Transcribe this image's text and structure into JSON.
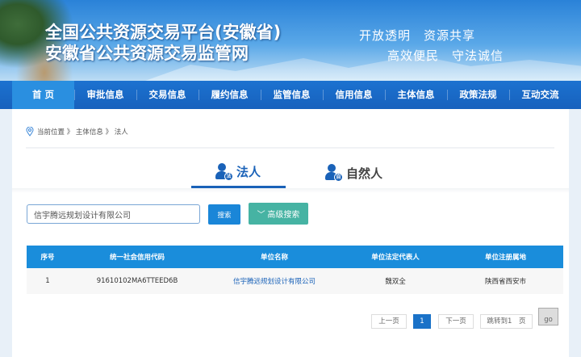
{
  "header": {
    "title_line1": "全国公共资源交易平台(安徽省)",
    "title_line2": "安徽省公共资源交易监管网",
    "slogan_line1": "开放透明　资源共享",
    "slogan_line2": "高效便民　守法诚信"
  },
  "nav": {
    "items": [
      {
        "label": "首 页",
        "active": true
      },
      {
        "label": "审批信息"
      },
      {
        "label": "交易信息"
      },
      {
        "label": "履约信息"
      },
      {
        "label": "监管信息"
      },
      {
        "label": "信用信息"
      },
      {
        "label": "主体信息"
      },
      {
        "label": "政策法规"
      },
      {
        "label": "互动交流"
      }
    ]
  },
  "breadcrumb": {
    "text": "当前位置 》 主体信息 》 法人"
  },
  "tabs": [
    {
      "label": "法人",
      "badge": "法",
      "active": true
    },
    {
      "label": "自然人",
      "badge": "自"
    }
  ],
  "search": {
    "value": "信宇腾远规划设计有限公司",
    "search_label": "搜索",
    "advanced_label": "﹀ 高级搜索"
  },
  "table": {
    "headers": [
      "序号",
      "统一社会信用代码",
      "单位名称",
      "单位法定代表人",
      "单位注册属地"
    ],
    "rows": [
      [
        "1",
        "91610102MA6TTEED6B",
        "信宇腾远规划设计有限公司",
        "魏双全",
        "陕西省西安市"
      ]
    ]
  },
  "pagination": {
    "prev": "上一页",
    "current": "1",
    "next": "下一页",
    "jump": "跳转到1　页",
    "go": "go"
  },
  "colors": {
    "nav": "#1761bd",
    "table_header": "#1a8ddb",
    "advanced": "#46b3a3"
  }
}
